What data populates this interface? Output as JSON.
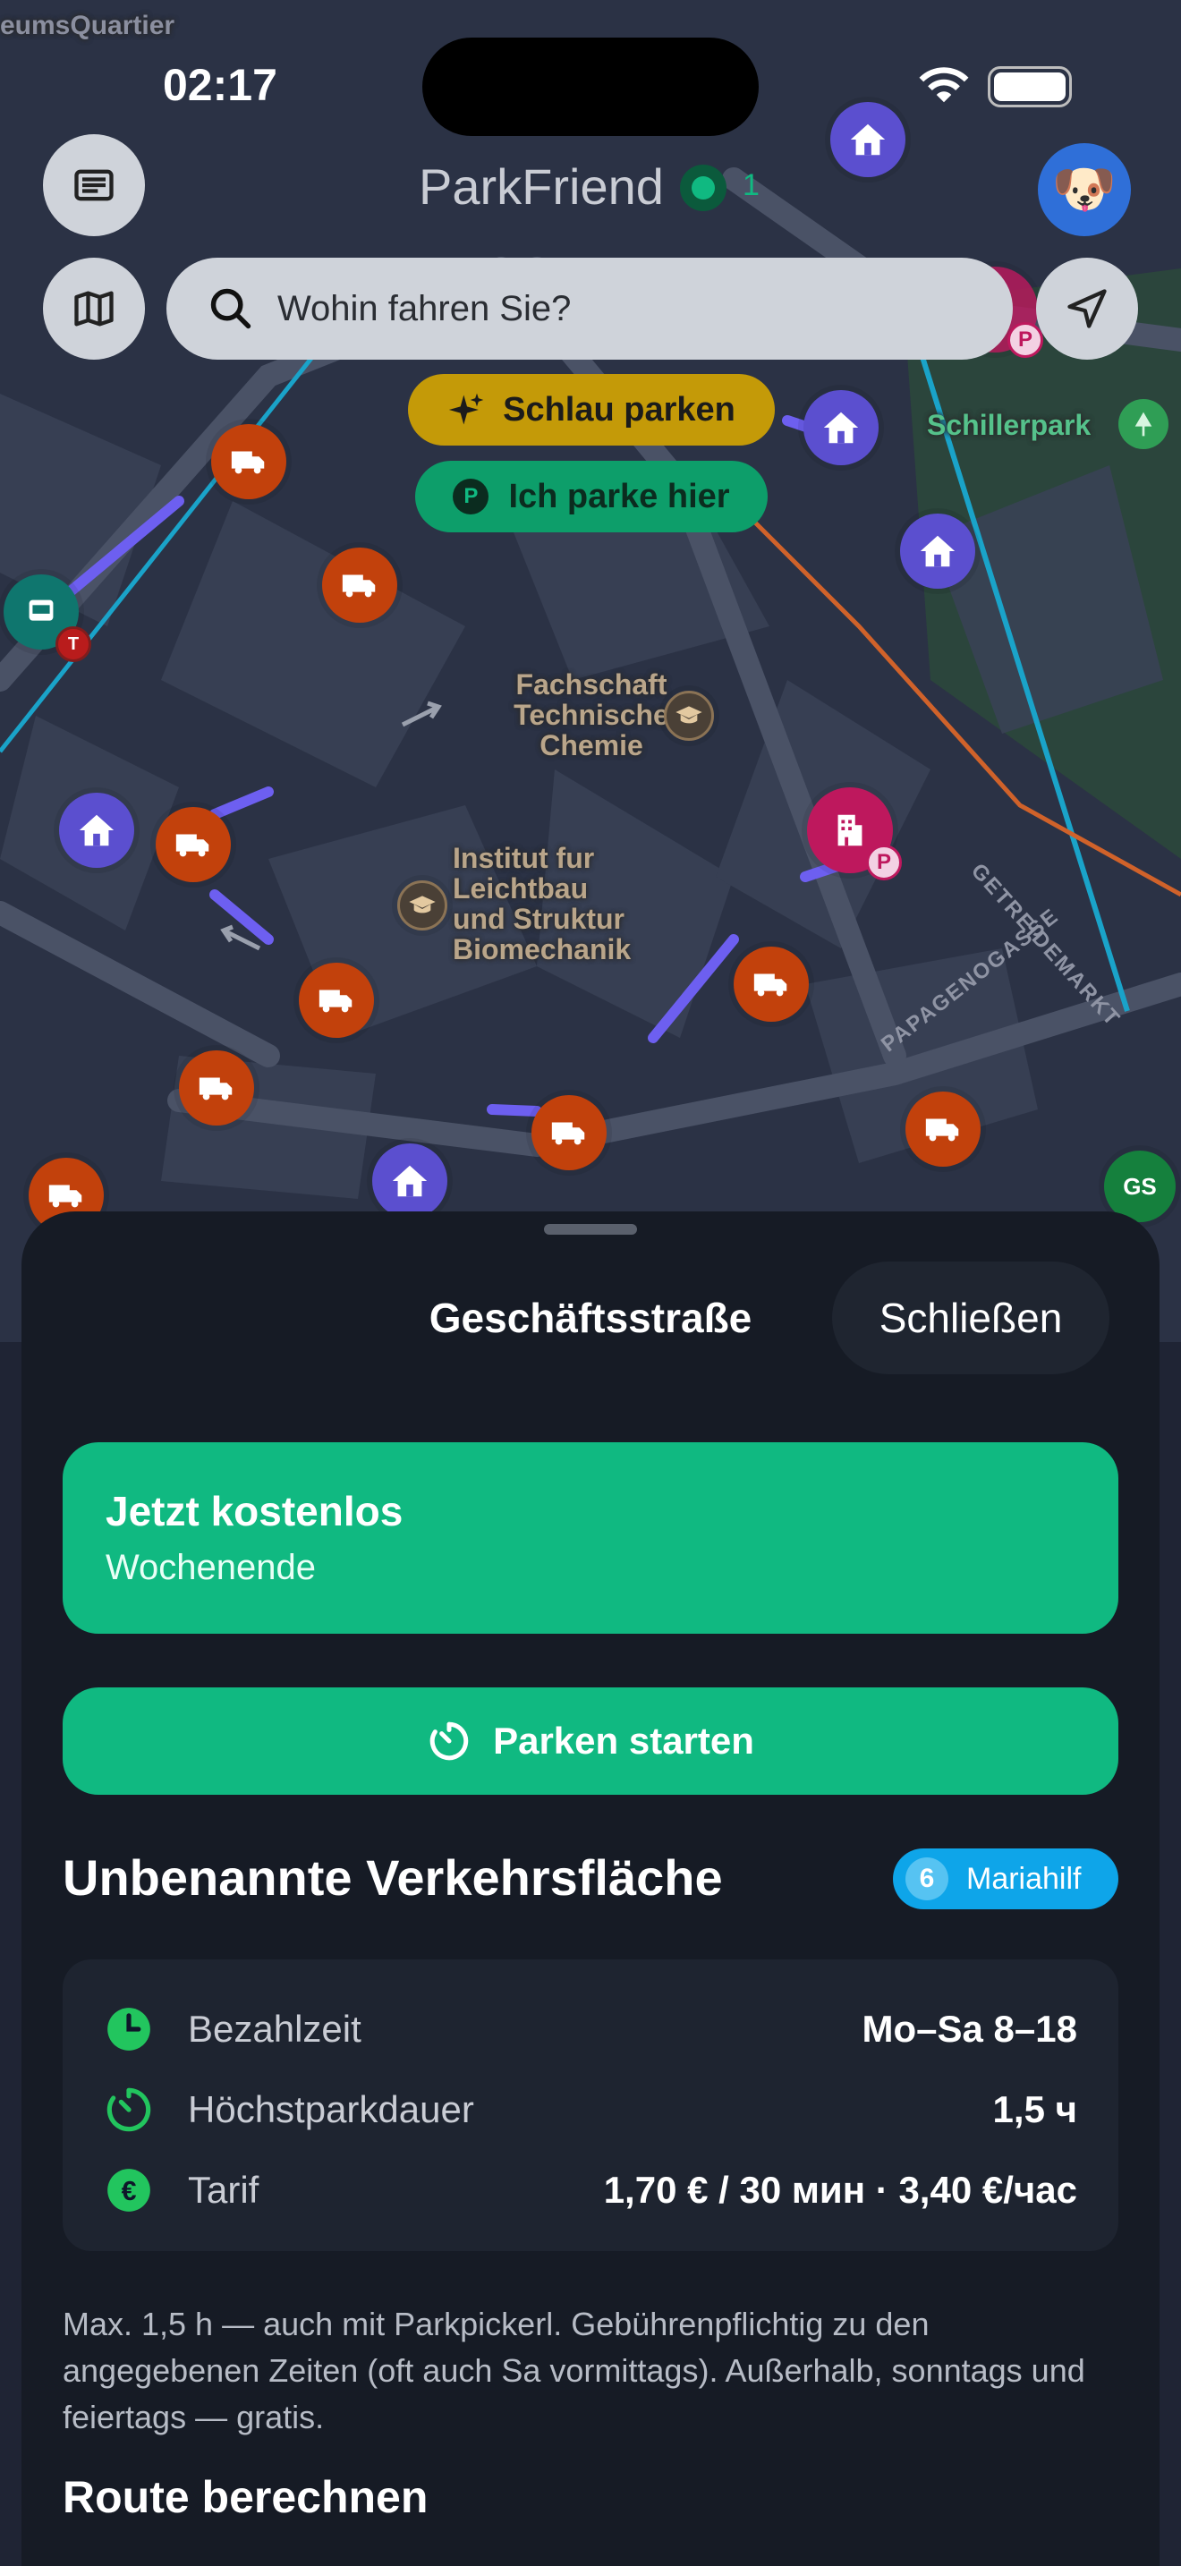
{
  "status_bar": {
    "time": "02:17"
  },
  "header": {
    "app_title": "ParkFriend",
    "online_count": "1",
    "avatar_emoji": "🐶"
  },
  "search": {
    "placeholder": "Wohin fahren Sie?"
  },
  "chips": {
    "smart_parking": "Schlau parken",
    "park_here": "Ich parke hier",
    "park_badge": "P"
  },
  "map": {
    "labels": {
      "schillerpark": "Schillerpark",
      "fachschaft_1": "Fachschaft",
      "fachschaft_2": "Technische",
      "fachschaft_3": "Chemie",
      "institut_1": "Institut fur",
      "institut_2": "Leichtbau",
      "institut_3": "und Struktur",
      "institut_4": "Biomechanik",
      "geitreidemarkt": "GETREIDEMARKT",
      "papagenogasse": "PAPAGENOGASSE",
      "museumsquartier": "eumsQuartier",
      "gs": "GS",
      "p": "P",
      "t": "T"
    },
    "colors": {
      "truck": "#c2410c",
      "house": "#5b4fcf",
      "hotel": "#be185d",
      "park": "#2f9e55"
    }
  },
  "sheet": {
    "title": "Geschäftsstraße",
    "close_label": "Schließen",
    "free_card": {
      "title": "Jetzt kostenlos",
      "subtitle": "Wochenende"
    },
    "start_button": "Parken starten",
    "street_name": "Unbenannte Verkehrsfläche",
    "district": {
      "number": "6",
      "name": "Mariahilf"
    },
    "info": [
      {
        "label": "Bezahlzeit",
        "value": "Mo–Sa 8–18",
        "icon": "clock-icon"
      },
      {
        "label": "Höchstparkdauer",
        "value": "1,5 ч",
        "icon": "timer-icon"
      },
      {
        "label": "Tarif",
        "value": "1,70 € / 30 мин · 3,40 €/час",
        "icon": "euro-icon"
      }
    ],
    "note": "Max. 1,5 h — auch mit Parkpickerl. Gebührenpflichtig zu den angegebenen Zeiten (oft auch Sa vormittags). Außerhalb, sonntags und feiertags — gratis.",
    "route_title": "Route berechnen"
  },
  "colors": {
    "accent": "#10b981",
    "sheet_bg": "#161b25",
    "card_bg": "#1e2430",
    "badge_blue": "#0ea5e9",
    "chip_yellow": "#c49a08"
  }
}
